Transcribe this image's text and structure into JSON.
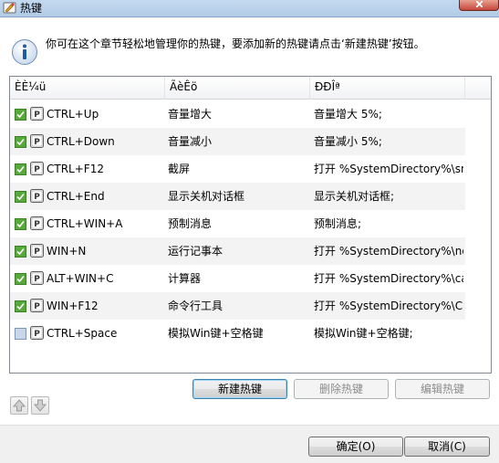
{
  "window": {
    "title": "热键"
  },
  "info": {
    "text": "你可在这个章节轻松地管理你的热键，要添加新的热键请点击‘新建热键’按钮。"
  },
  "table": {
    "headers": [
      "ÈÈ¼ü",
      "ÃèÊö",
      "ÐÐÎª"
    ],
    "rows": [
      {
        "checked": true,
        "key": "CTRL+Up",
        "desc": "音量增大",
        "action": "音量增大 5%;"
      },
      {
        "checked": true,
        "key": "CTRL+Down",
        "desc": "音量减小",
        "action": "音量减小 5%;"
      },
      {
        "checked": true,
        "key": "CTRL+F12",
        "desc": "截屏",
        "action": "打开 %SystemDirectory%\\snip..."
      },
      {
        "checked": true,
        "key": "CTRL+End",
        "desc": "显示关机对话框",
        "action": "显示关机对话框;"
      },
      {
        "checked": true,
        "key": "CTRL+WIN+A",
        "desc": "预制消息",
        "action": "预制消息;"
      },
      {
        "checked": true,
        "key": "WIN+N",
        "desc": "运行记事本",
        "action": "打开 %SystemDirectory%\\note..."
      },
      {
        "checked": true,
        "key": "ALT+WIN+C",
        "desc": "计算器",
        "action": "打开 %SystemDirectory%\\calc...."
      },
      {
        "checked": true,
        "key": "WIN+F12",
        "desc": "命令行工具",
        "action": "打开 %SystemDirectory%\\Cmd..."
      },
      {
        "checked": false,
        "key": "CTRL+Space",
        "desc": "模拟Win键+空格键",
        "action": "模拟Win键+空格键;"
      }
    ]
  },
  "buttons": {
    "new": "新建热键",
    "delete": "删除热键",
    "edit": "编辑热键",
    "ok": "确定(O)",
    "cancel": "取消(C)"
  },
  "colors": {
    "check_green": "#57a93c",
    "titlebar": "#b9d1ea",
    "stripe": "#f3f3f3"
  }
}
